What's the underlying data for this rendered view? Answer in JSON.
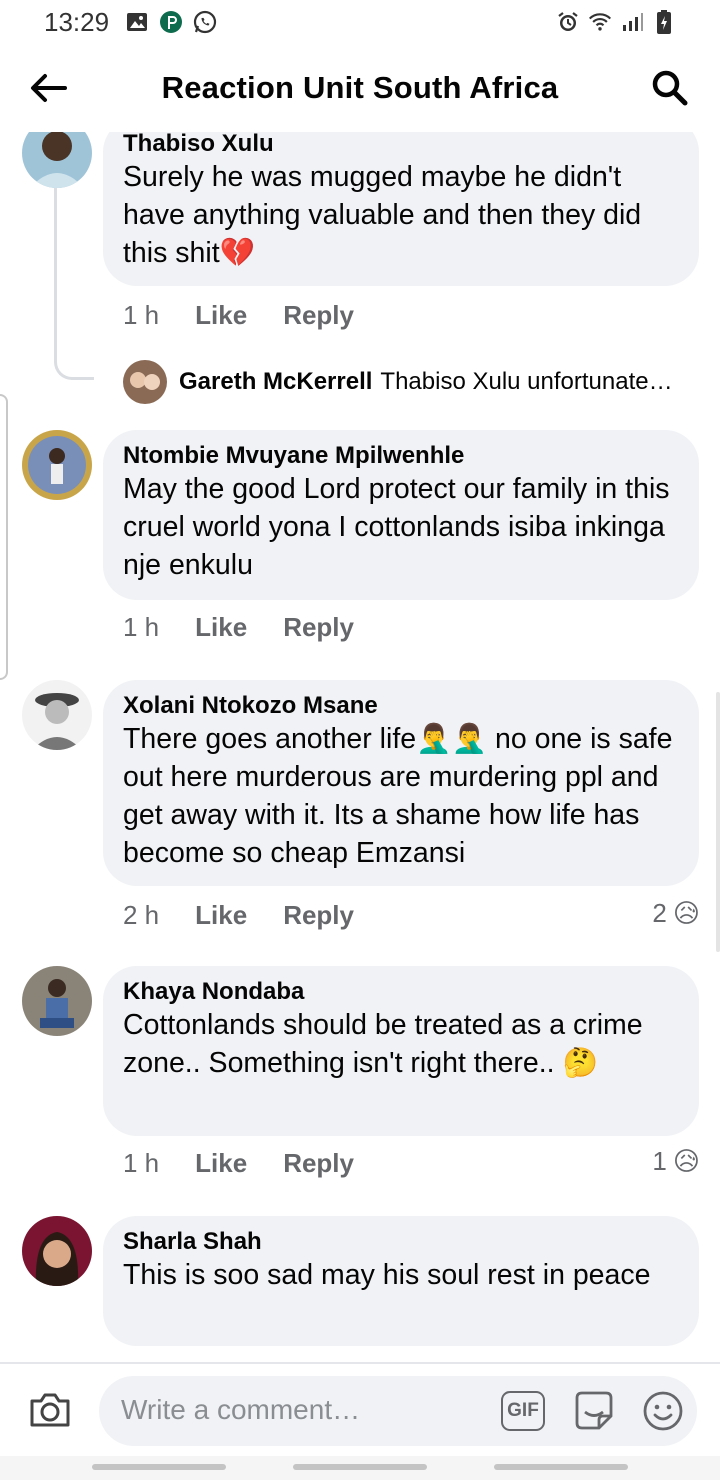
{
  "status": {
    "time": "13:29",
    "left_icons": [
      "gallery-icon",
      "p-app-icon",
      "whatsapp-icon"
    ],
    "right_icons": [
      "alarm-icon",
      "wifi-icon",
      "signal-icon",
      "battery-charging-icon"
    ]
  },
  "header": {
    "title": "Reaction Unit South Africa",
    "back_icon": "arrow-left-icon",
    "search_icon": "search-icon"
  },
  "comments": [
    {
      "author": "Thabiso Xulu",
      "text": "Surely he was mugged maybe he didn't have anything valuable and then they did this shit💔",
      "time": "1 h",
      "like": "Like",
      "reply": "Reply",
      "reply_preview": {
        "author": "Gareth McKerrell",
        "text": "Thabiso Xulu unfortunate…"
      }
    },
    {
      "author": "Ntombie Mvuyane Mpilwenhle",
      "text": "May the good Lord protect our family in this cruel world yona I cottonlands isiba inkinga nje enkulu",
      "time": "1 h",
      "like": "Like",
      "reply": "Reply"
    },
    {
      "author": "Xolani Ntokozo Msane",
      "text": "There goes another life🤦‍♂️🤦‍♂️ no one is safe out here murderous are murdering ppl and get away with it. Its a shame how life has become so cheap Emzansi",
      "time": "2 h",
      "like": "Like",
      "reply": "Reply",
      "reactions": {
        "count": "2",
        "emoji": "😥"
      }
    },
    {
      "author": "Khaya Nondaba",
      "text": "Cottonlands should be treated as a crime zone.. Something isn't right there.. 🤔",
      "time": "1 h",
      "like": "Like",
      "reply": "Reply",
      "reactions": {
        "count": "1",
        "emoji": "😥"
      }
    },
    {
      "author": "Sharla Shah",
      "text": "This is soo sad may his soul rest in peace"
    }
  ],
  "composer": {
    "placeholder": "Write a comment…",
    "gif_label": "GIF",
    "camera_icon": "camera-icon",
    "sticker_icon": "sticker-icon",
    "emoji_icon": "smiley-icon"
  },
  "colors": {
    "bubble": "#f0f2f5",
    "secondary_text": "#65676b",
    "text": "#050505"
  }
}
